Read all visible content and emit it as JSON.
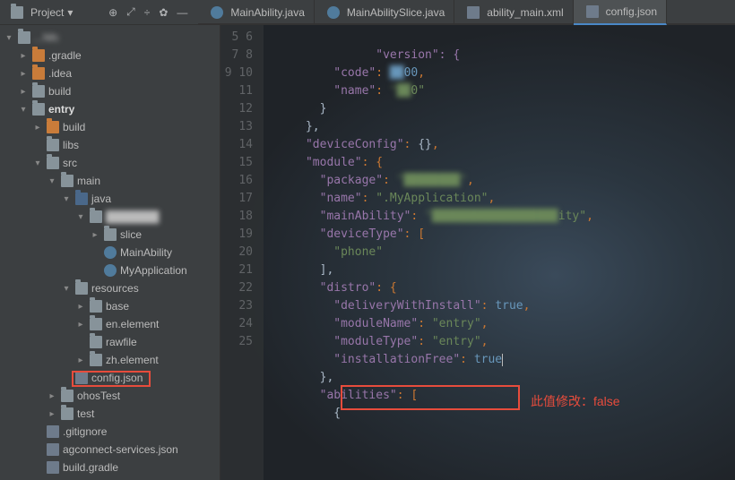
{
  "header": {
    "project_label": "Project"
  },
  "tabs": [
    {
      "label": "MainAbility.java",
      "icon": "class-icon"
    },
    {
      "label": "MainAbilitySlice.java",
      "icon": "class-icon"
    },
    {
      "label": "ability_main.xml",
      "icon": "file-icon"
    },
    {
      "label": "config.json",
      "icon": "file-icon",
      "active": true
    }
  ],
  "tree": {
    "root_blur": "...Nfc",
    "items": [
      ".gradle",
      ".idea",
      "build",
      "entry",
      "build",
      "libs",
      "src",
      "main",
      "java",
      "slice",
      "MainAbility",
      "MyApplication",
      "resources",
      "base",
      "en.element",
      "rawfile",
      "zh.element",
      "config.json",
      "ohosTest",
      "test",
      ".gitignore",
      "agconnect-services.json",
      "build.gradle"
    ],
    "entry_label": "entry",
    "config_label": "config.json"
  },
  "gutter_start": 5,
  "gutter_end": 25,
  "code": {
    "l5": "        \"version\": {",
    "l6_key": "\"code\"",
    "l6_val": "00",
    "l7_key": "\"name\"",
    "l7_val": "0\"",
    "l8": "        }",
    "l9": "      },",
    "l10_key": "\"deviceConfig\"",
    "l10_val": "{}",
    "l11_key": "\"module\"",
    "l12_key": "\"package\"",
    "l13_key": "\"name\"",
    "l13_val": "\".MyApplication\"",
    "l14_key": "\"mainAbility\"",
    "l14_val_tail": "ity\"",
    "l15_key": "\"deviceType\"",
    "l16_val": "\"phone\"",
    "l17": "        ],",
    "l18_key": "\"distro\"",
    "l19_key": "\"deliveryWithInstall\"",
    "l19_val": "true",
    "l20_key": "\"moduleName\"",
    "l20_val": "\"entry\"",
    "l21_key": "\"moduleType\"",
    "l21_val": "\"entry\"",
    "l22_key": "\"installationFree\"",
    "l22_val": "true",
    "l23": "        },",
    "l24_key": "\"abilities\"",
    "l25": "          {"
  },
  "annotation": "此值修改：false"
}
